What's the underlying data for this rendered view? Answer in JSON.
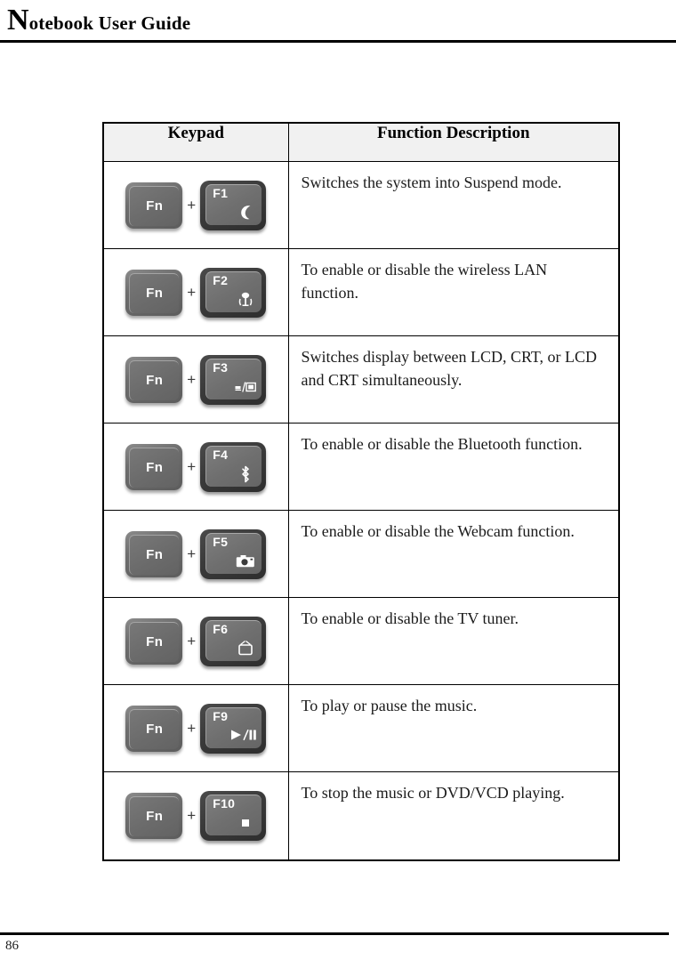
{
  "header": {
    "title_dropcap": "N",
    "title_rest": "otebook User Guide"
  },
  "footer": {
    "page_number": "86"
  },
  "table": {
    "columns": [
      {
        "header": "Keypad"
      },
      {
        "header": "Function Description"
      }
    ],
    "plus_symbol": "+",
    "modifier_key_label": "Fn",
    "rows": [
      {
        "modifier": "Fn",
        "fkey": "F1",
        "icon": "moon-suspend-icon",
        "description": "Switches the system into Suspend mode."
      },
      {
        "modifier": "Fn",
        "fkey": "F2",
        "icon": "wireless-lan-icon",
        "description": "To enable or disable the wireless LAN function."
      },
      {
        "modifier": "Fn",
        "fkey": "F3",
        "icon": "display-switch-icon",
        "description": "Switches display between LCD, CRT, or LCD and CRT simultaneously."
      },
      {
        "modifier": "Fn",
        "fkey": "F4",
        "icon": "bluetooth-icon",
        "description": "To enable or disable the Bluetooth function."
      },
      {
        "modifier": "Fn",
        "fkey": "F5",
        "icon": "webcam-camera-icon",
        "description": "To enable or disable the Webcam function."
      },
      {
        "modifier": "Fn",
        "fkey": "F6",
        "icon": "tv-tuner-icon",
        "description": "To enable or disable the TV tuner."
      },
      {
        "modifier": "Fn",
        "fkey": "F9",
        "icon": "play-pause-icon",
        "description": "To play or pause the music."
      },
      {
        "modifier": "Fn",
        "fkey": "F10",
        "icon": "stop-icon",
        "description": "To stop the music or DVD/VCD playing."
      }
    ]
  }
}
